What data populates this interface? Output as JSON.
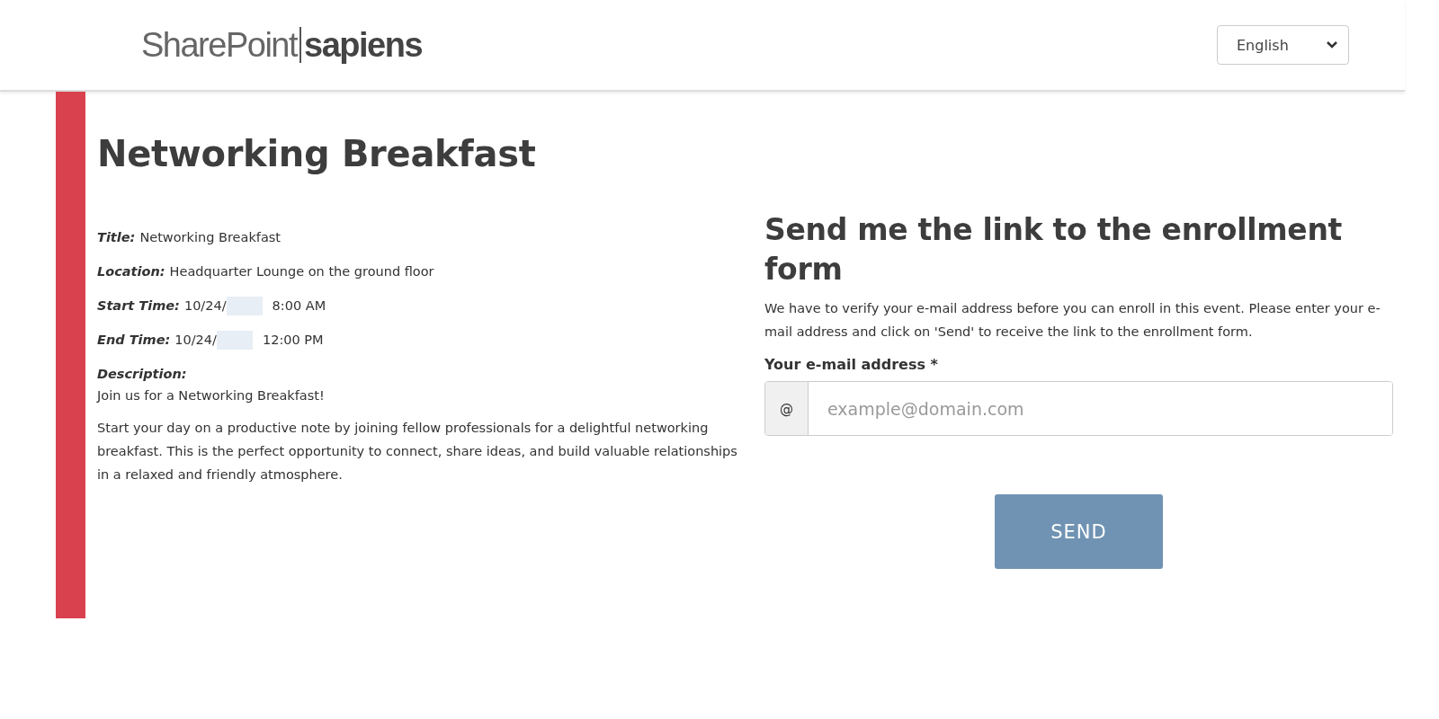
{
  "header": {
    "logo": {
      "light": "SharePoint",
      "bold": "sapiens"
    },
    "language": {
      "value": "English"
    }
  },
  "event": {
    "heading": "Networking Breakfast",
    "details": [
      {
        "label": "Title:",
        "value": "Networking Breakfast"
      },
      {
        "label": "Location:",
        "value": "Headquarter Lounge on the ground floor"
      },
      {
        "label": "Start Time:",
        "value": "10/24/",
        "redacted": true,
        "after": "8:00 AM"
      },
      {
        "label": "End Time:",
        "value": "10/24/",
        "redacted": true,
        "after": "12:00 PM"
      }
    ],
    "description": {
      "label": "Description:",
      "paragraphs": [
        "Join us for a Networking Breakfast!",
        "Start your day on a productive note by joining fellow professionals for a delightful networking breakfast. This is the perfect opportunity to connect, share ideas, and build valuable relationships in a relaxed and friendly atmosphere."
      ]
    }
  },
  "enrollment": {
    "heading": "Send me the link to the enrollment form",
    "intro": "We have to verify your e-mail address before you can enroll in this event. Please enter your e-mail address and click on 'Send' to receive the link to the enrollment form.",
    "email_field": {
      "label": "Your e-mail address *",
      "prefix": "@",
      "placeholder": "example@domain.com"
    },
    "button": "SEND"
  }
}
